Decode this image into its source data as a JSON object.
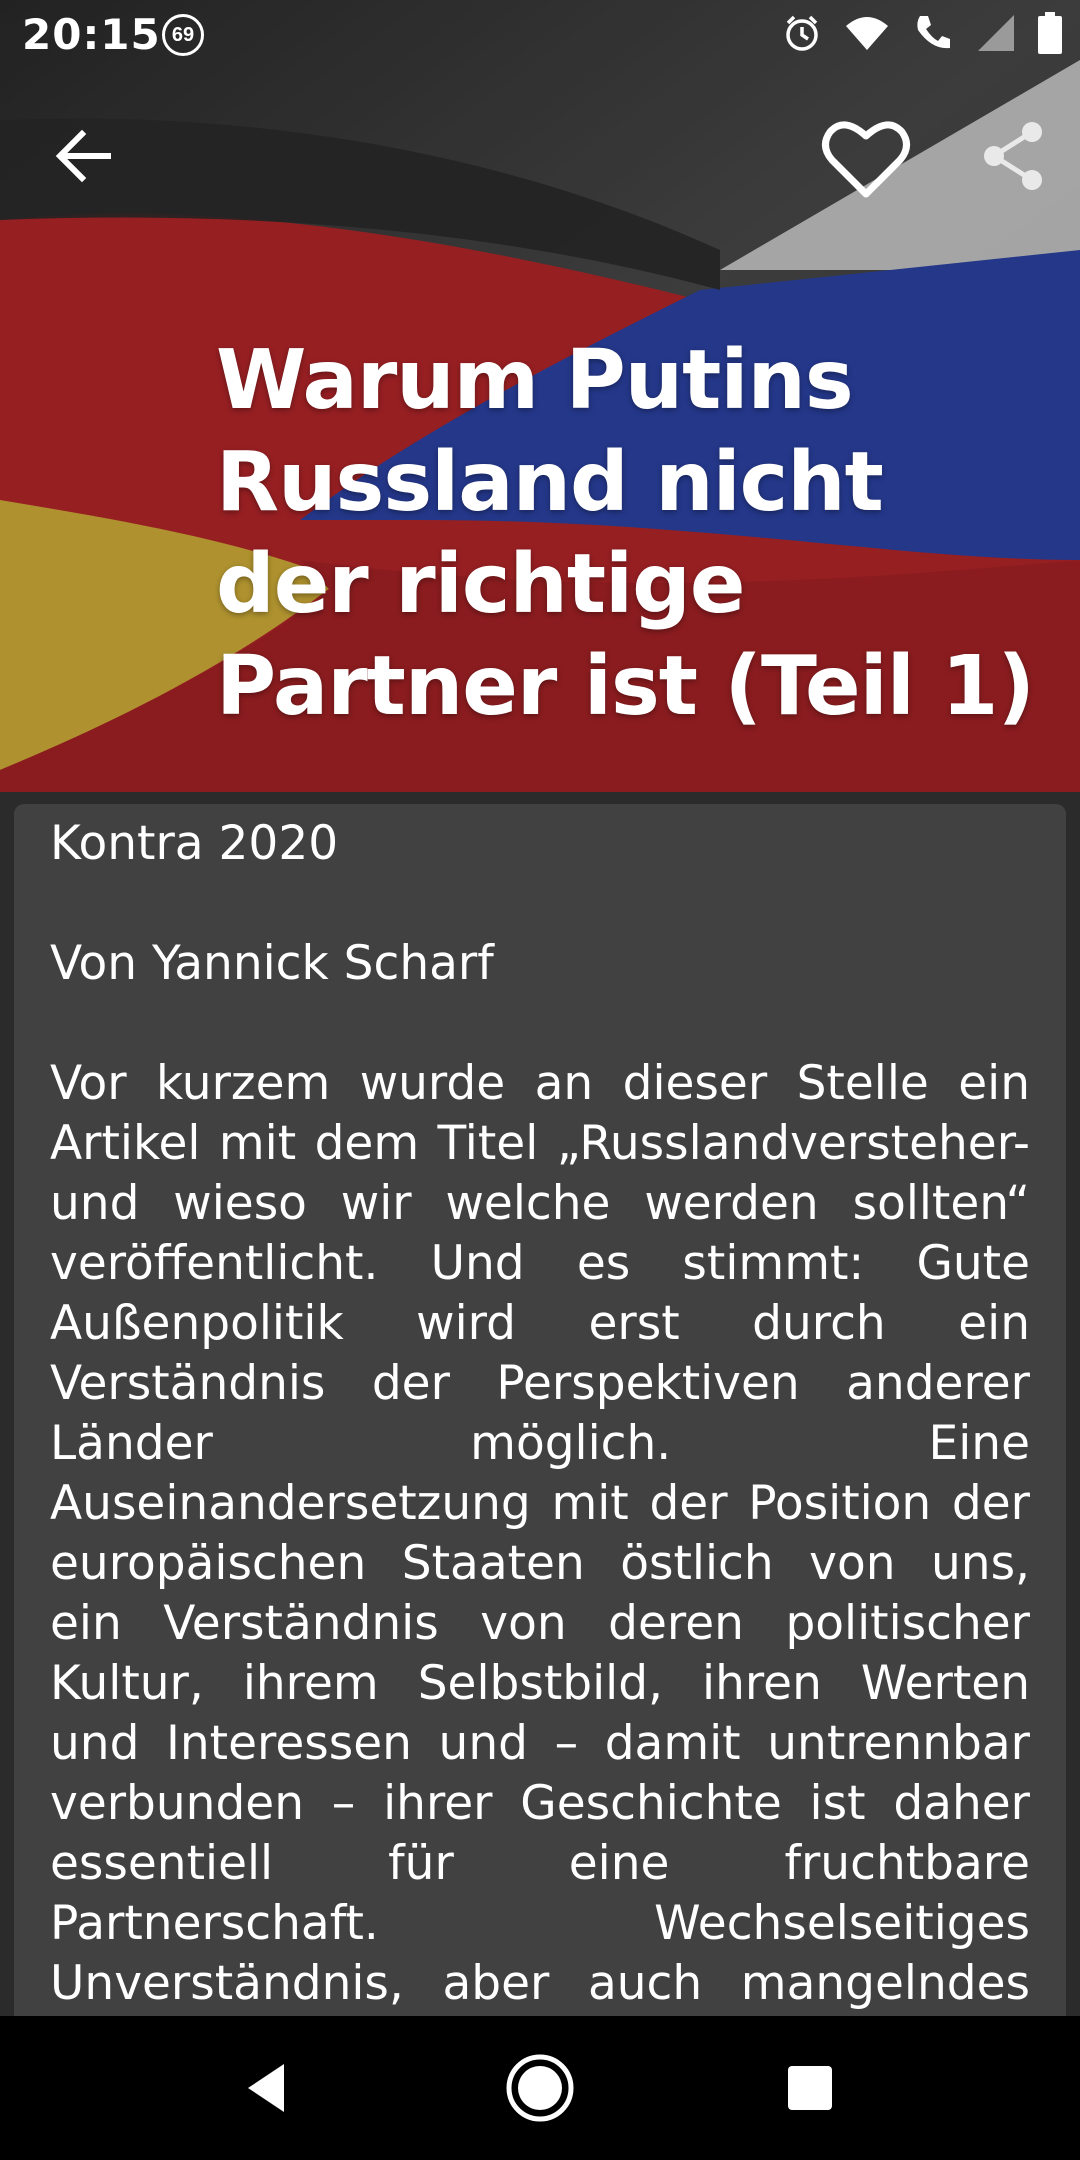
{
  "status_bar": {
    "time": "20:15",
    "notification_count": "69",
    "icons": [
      "alarm-icon",
      "wifi-icon",
      "call-icon",
      "signal-icon",
      "battery-icon"
    ]
  },
  "toolbar": {
    "back_icon": "arrow-back-icon",
    "favorite_icon": "heart-outline-icon",
    "share_icon": "share-icon"
  },
  "article": {
    "title": "Warum Putins Russland nicht der richtige Partner ist (Teil 1)",
    "category": "Kontra 2020",
    "author": "Von Yannick Scharf",
    "body": "Vor kurzem wurde an dieser Stelle ein Artikel mit dem Titel „Russlandversteher- und wieso wir welche werden sollten“ veröffentlicht. Und es stimmt: Gute Außenpolitik wird erst durch ein Verständnis der Perspektiven anderer Länder möglich. Eine Auseinandersetzung mit der Position der europäischen Staaten östlich von uns, ein Verständnis von deren politischer Kultur, ihrem Selbstbild, ihren Werten und Interessen und – damit untrennbar verbunden – ihrer Geschichte ist daher essentiell für eine fruchtbare Partnerschaft. Wechselseitiges Unverständnis, aber auch mangelndes Interesse der westlichen Seite sind immer"
  },
  "nav_bar": {
    "back_icon": "nav-back-triangle-icon",
    "home_icon": "nav-home-circle-icon",
    "recents_icon": "nav-recents-square-icon"
  }
}
